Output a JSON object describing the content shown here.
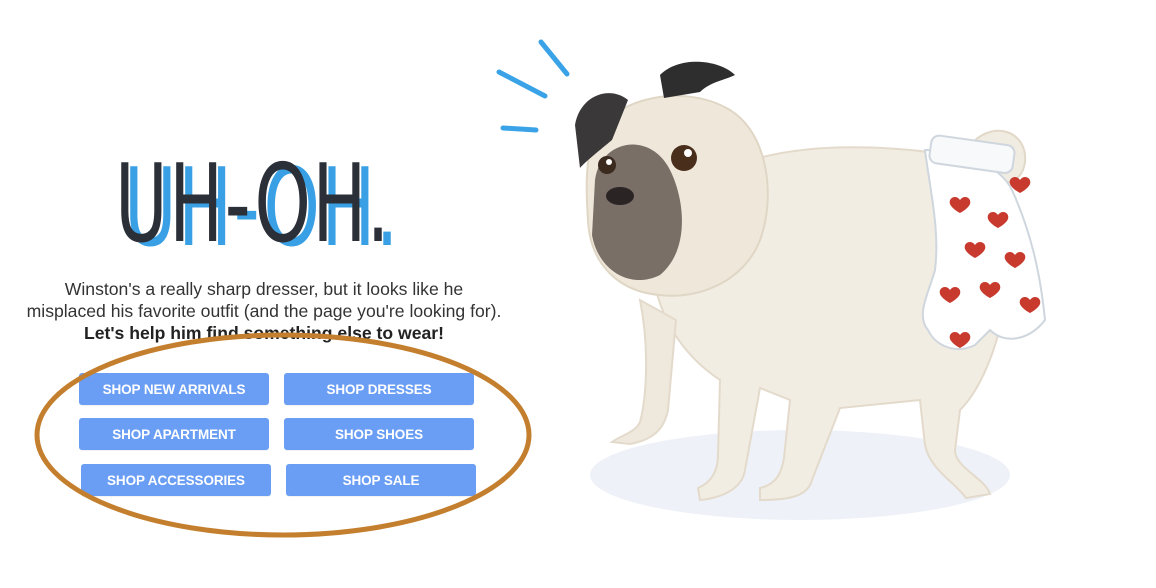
{
  "headline": "UH-OH.",
  "message": {
    "line1": "Winston's a really sharp dresser, but it looks like he",
    "line2": "misplaced his favorite outfit (and the page you're looking for).",
    "line3": "Let's help him find something else to wear!"
  },
  "buttons": {
    "new_arrivals": "SHOP NEW ARRIVALS",
    "dresses": "SHOP DRESSES",
    "apartment": "SHOP APARTMENT",
    "shoes": "SHOP SHOES",
    "accessories": "SHOP ACCESSORIES",
    "sale": "SHOP SALE"
  },
  "colors": {
    "button": "#6a9ef5",
    "headline": "#2b2f38",
    "headline_shadow": "#39a0e5",
    "annotation": "#c47f2e"
  },
  "illustration": "pug-in-heart-boxers-illustration"
}
